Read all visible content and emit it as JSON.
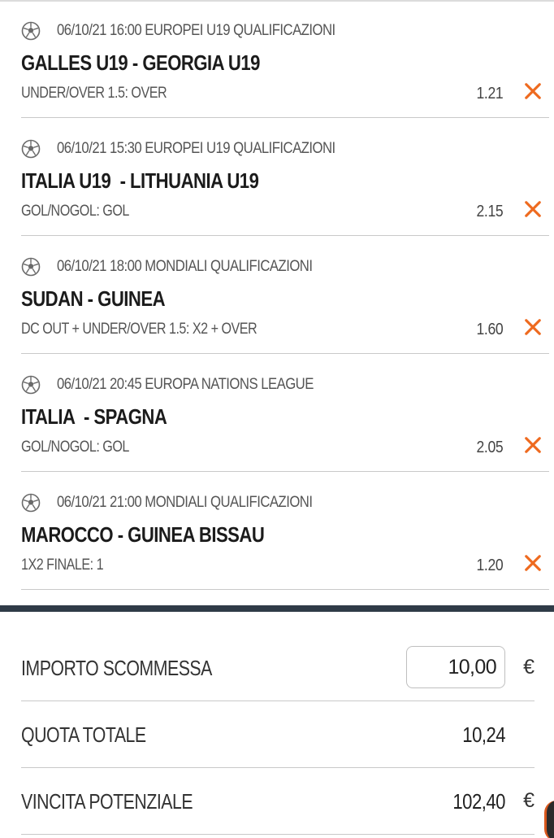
{
  "bets": [
    {
      "datetime": "06/10/21 16:00",
      "competition": "EUROPEI U19 QUALIFICAZIONI",
      "teams": "GALLES U19 - GEORGIA U19",
      "market": "UNDER/OVER 1.5: OVER",
      "odd": "1.21",
      "icon": "soccer-ball-icon",
      "remove_icon": "close-icon"
    },
    {
      "datetime": "06/10/21 15:30",
      "competition": "EUROPEI U19 QUALIFICAZIONI",
      "teams": "ITALIA U19  - LITHUANIA U19",
      "market": "GOL/NOGOL: GOL",
      "odd": "2.15",
      "icon": "soccer-ball-icon",
      "remove_icon": "close-icon"
    },
    {
      "datetime": "06/10/21 18:00",
      "competition": "MONDIALI QUALIFICAZIONI",
      "teams": "SUDAN - GUINEA",
      "market": "DC OUT + UNDER/OVER 1.5: X2 + OVER",
      "odd": "1.60",
      "icon": "soccer-ball-icon",
      "remove_icon": "close-icon"
    },
    {
      "datetime": "06/10/21 20:45",
      "competition": "EUROPA NATIONS LEAGUE",
      "teams": "ITALIA  - SPAGNA",
      "market": "GOL/NOGOL: GOL",
      "odd": "2.05",
      "icon": "soccer-ball-icon",
      "remove_icon": "close-icon"
    },
    {
      "datetime": "06/10/21 21:00",
      "competition": "MONDIALI QUALIFICAZIONI",
      "teams": "MAROCCO - GUINEA BISSAU",
      "market": "1X2 FINALE: 1",
      "odd": "1.20",
      "icon": "soccer-ball-icon",
      "remove_icon": "close-icon"
    }
  ],
  "summary": {
    "stake_label": "IMPORTO SCOMMESSA",
    "stake_value": "10,00",
    "stake_currency": "€",
    "total_odds_label": "QUOTA TOTALE",
    "total_odds_value": "10,24",
    "potential_win_label": "VINCITA POTENZIALE",
    "potential_win_value": "102,40",
    "potential_win_currency": "€"
  },
  "colors": {
    "accent": "#ee6a1f",
    "divider": "#2f3b47",
    "text_muted": "#555555"
  }
}
